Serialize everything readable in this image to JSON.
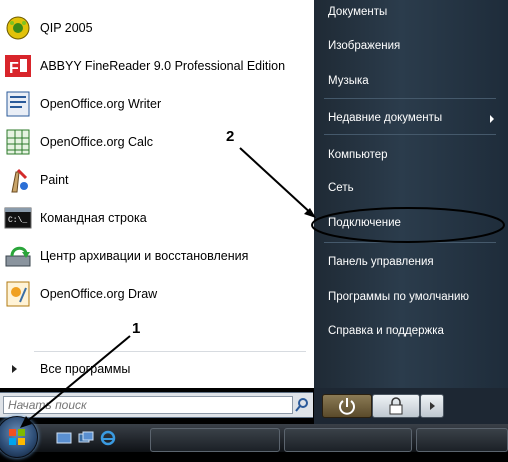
{
  "programs": [
    {
      "label": "QIP 2005",
      "icon": "qip-icon"
    },
    {
      "label": "ABBYY FineReader 9.0 Professional Edition",
      "icon": "finereader-icon"
    },
    {
      "label": "OpenOffice.org Writer",
      "icon": "writer-icon"
    },
    {
      "label": "OpenOffice.org Calc",
      "icon": "calc-icon"
    },
    {
      "label": "Paint",
      "icon": "paint-icon"
    },
    {
      "label": "Командная строка",
      "icon": "cmd-icon"
    },
    {
      "label": "Центр архивации и восстановления",
      "icon": "backup-icon"
    },
    {
      "label": "OpenOffice.org Draw",
      "icon": "draw-icon"
    }
  ],
  "all_programs": "Все программы",
  "search": {
    "placeholder": "Начать поиск"
  },
  "right_menu": [
    "Документы",
    "Изображения",
    "Музыка",
    "Недавние документы",
    "Компьютер",
    "Сеть",
    "Подключение",
    "Панель управления",
    "Программы по умолчанию",
    "Справка и поддержка"
  ],
  "annotations": {
    "one": "1",
    "two": "2"
  },
  "colors": {
    "right_panel": "#2b3c4c",
    "highlight_ring": "#000000",
    "accent_blue": "#3a6ea5"
  }
}
